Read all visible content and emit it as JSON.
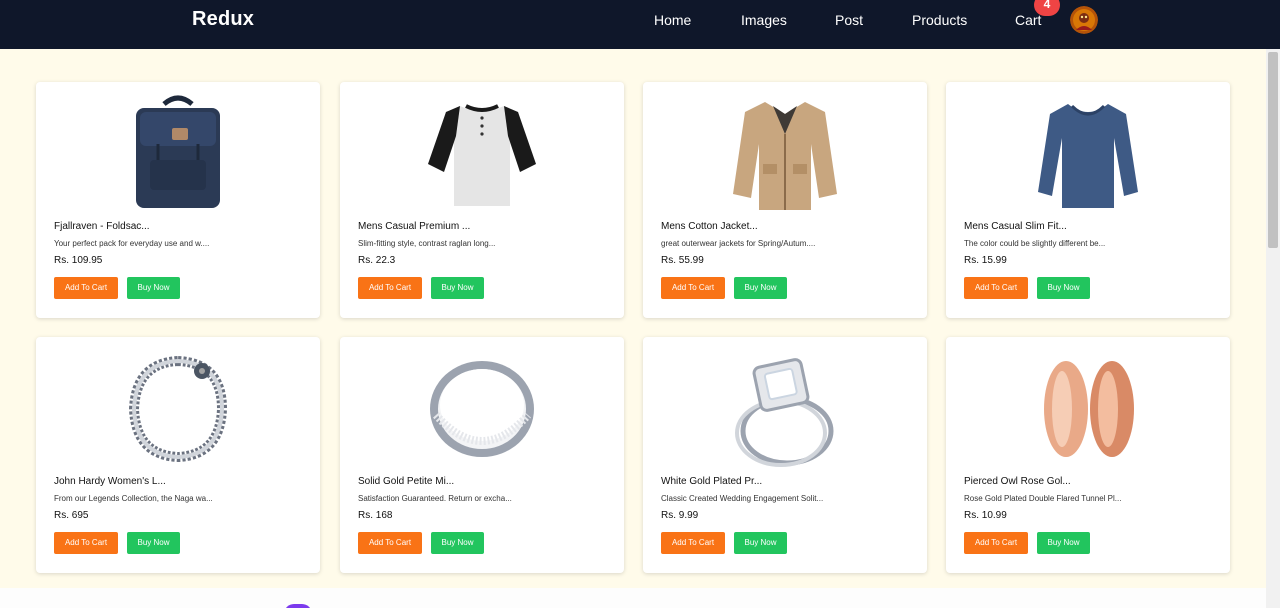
{
  "header": {
    "brand": "Redux",
    "nav": {
      "home": "Home",
      "images": "Images",
      "post": "Post",
      "products": "Products",
      "cart": "Cart"
    },
    "cart_count": "4"
  },
  "products": [
    {
      "title": "Fjallraven - Foldsac...",
      "description": "Your perfect pack for everyday use and w....",
      "price": "Rs. 109.95",
      "add_label": "Add To Cart",
      "buy_label": "Buy Now",
      "image_icon": "backpack-icon"
    },
    {
      "title": "Mens Casual Premium ...",
      "description": "Slim-fitting style, contrast raglan long...",
      "price": "Rs. 22.3",
      "add_label": "Add To Cart",
      "buy_label": "Buy Now",
      "image_icon": "raglan-tshirt-icon"
    },
    {
      "title": "Mens Cotton Jacket...",
      "description": "great outerwear jackets for Spring/Autum....",
      "price": "Rs. 55.99",
      "add_label": "Add To Cart",
      "buy_label": "Buy Now",
      "image_icon": "jacket-icon"
    },
    {
      "title": "Mens Casual Slim Fit...",
      "description": "The color could be slightly different be...",
      "price": "Rs. 15.99",
      "add_label": "Add To Cart",
      "buy_label": "Buy Now",
      "image_icon": "long-sleeve-shirt-icon"
    },
    {
      "title": "John Hardy Women's L...",
      "description": "From our Legends Collection, the Naga wa...",
      "price": "Rs. 695",
      "add_label": "Add To Cart",
      "buy_label": "Buy Now",
      "image_icon": "chain-bracelet-icon"
    },
    {
      "title": "Solid Gold Petite Mi...",
      "description": "Satisfaction Guaranteed. Return or excha...",
      "price": "Rs. 168",
      "add_label": "Add To Cart",
      "buy_label": "Buy Now",
      "image_icon": "silver-ring-icon"
    },
    {
      "title": "White Gold Plated Pr...",
      "description": "Classic Created Wedding Engagement Solit...",
      "price": "Rs. 9.99",
      "add_label": "Add To Cart",
      "buy_label": "Buy Now",
      "image_icon": "diamond-ring-icon"
    },
    {
      "title": "Pierced Owl Rose Gol...",
      "description": "Rose Gold Plated Double Flared Tunnel Pl...",
      "price": "Rs. 10.99",
      "add_label": "Add To Cart",
      "buy_label": "Buy Now",
      "image_icon": "rose-gold-tunnel-icon"
    }
  ],
  "colors": {
    "navbar": "#0f172a",
    "page_background": "#fffbea",
    "add_to_cart": "#f97316",
    "buy_now": "#22c55e",
    "cart_badge": "#ef4444"
  }
}
